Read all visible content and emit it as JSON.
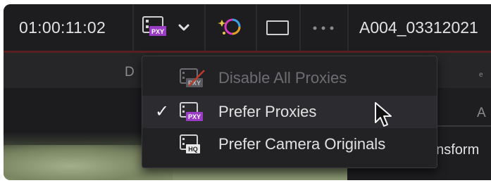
{
  "toolbar": {
    "timecode": "01:00:11:02",
    "proxy_badge": "PXY",
    "clip_name": "A004_03312021"
  },
  "dropdown": {
    "items": [
      {
        "label": "Disable All Proxies",
        "checked": false,
        "enabled": false,
        "icon": "pxy-disabled-icon",
        "badge": "PXY"
      },
      {
        "label": "Prefer Proxies",
        "checked": true,
        "enabled": true,
        "icon": "pxy-icon",
        "badge": "PXY"
      },
      {
        "label": "Prefer Camera Originals",
        "checked": false,
        "enabled": true,
        "icon": "hq-icon",
        "badge": "HQ"
      }
    ],
    "check_glyph": "✓"
  },
  "panel": {
    "left_tab_fragment": "D",
    "right_tab_fragment": "A",
    "right_tab_small": "e",
    "transform_label": "ansform"
  },
  "colors": {
    "accent_purple": "#9b3cc6",
    "red_bar": "#5a1f22"
  }
}
